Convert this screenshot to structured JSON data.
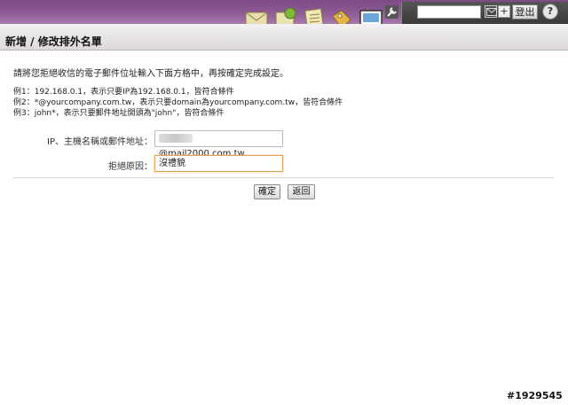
{
  "header": {
    "search_value": "",
    "logout_label": "登出",
    "help_label": "?",
    "plus_label": "+"
  },
  "page": {
    "title": "新增 / 修改排外名單"
  },
  "main": {
    "intro": "請將您拒絕收信的電子郵件位址輸入下面方格中，再按確定完成設定。",
    "examples": [
      "例1：192.168.0.1，表示只要IP為192.168.0.1，皆符合條件",
      "例2：*@yourcompany.com.tw，表示只要domain為yourcompany.com.tw，皆符合條件",
      "例3：john*，表示只要郵件地址開頭為\"john\"，皆符合條件"
    ],
    "address_label": "IP、主機名稱或郵件地址：",
    "address_value": "@mail2000.com.tw",
    "reason_label": "拒絕原因：",
    "reason_value": "沒禮貌",
    "confirm_label": "確定",
    "back_label": "返回"
  },
  "watermark": "#1929545",
  "colors": {
    "topbar": "#8e5b95",
    "focus_border": "#e3a45a"
  },
  "icons": [
    "envelope-icon",
    "leaf-icon",
    "notepad-icon",
    "tag-icon",
    "monitor-icon",
    "wrench-icon",
    "mail-search-icon"
  ]
}
